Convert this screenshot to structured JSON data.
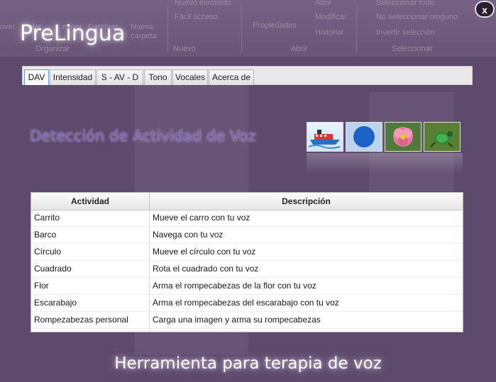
{
  "background_ribbon": {
    "labels": [
      "over",
      "olar",
      "minar",
      "Cambiar",
      "Nueva carpeta",
      "Nuevo elemento",
      "Fácil acceso",
      "Propiedades",
      "Abrir",
      "Modificar",
      "Historial",
      "Seleccionar todo",
      "No seleccionar ninguno",
      "Invertir selección"
    ],
    "groups": [
      "Organizar",
      "Nuevo",
      "Abrir",
      "Seleccionar"
    ]
  },
  "app": {
    "title": "PreLingua",
    "close_label": "x",
    "footer": "Herramienta para terapia de voz"
  },
  "tabs": [
    {
      "label": "DAV",
      "active": true
    },
    {
      "label": "Intensidad",
      "active": false
    },
    {
      "label": "S - AV - D",
      "active": false
    },
    {
      "label": "Tono",
      "active": false
    },
    {
      "label": "Vocales",
      "active": false
    },
    {
      "label": "Acerca de",
      "active": false
    }
  ],
  "section": {
    "title": "Detección de Actividad de Voz",
    "thumbnails": [
      "boat-image",
      "circle-image",
      "flower-image",
      "beetle-image"
    ]
  },
  "table": {
    "headers": [
      "Actividad",
      "Descripción"
    ],
    "rows": [
      {
        "activity": "Carrito",
        "description": "Mueve el carro con tu voz"
      },
      {
        "activity": "Barco",
        "description": "Navega con tu voz"
      },
      {
        "activity": "Círculo",
        "description": "Mueve el círculo con tu voz"
      },
      {
        "activity": "Cuadrado",
        "description": "Rota el cuadrado con tu voz"
      },
      {
        "activity": "Flor",
        "description": "Arma el rompecabezas de la flor con tu voz"
      },
      {
        "activity": "Escarabajo",
        "description": "Arma el rompecabezas del escarabajo con tu voz"
      },
      {
        "activity": "Rompezabezas personal",
        "description": "Carga una imagen y arma su rompecabezas"
      }
    ]
  },
  "colors": {
    "background": "#5e4a6c",
    "title_accent": "#7e63b8",
    "circle_blue": "#1d63c7"
  }
}
